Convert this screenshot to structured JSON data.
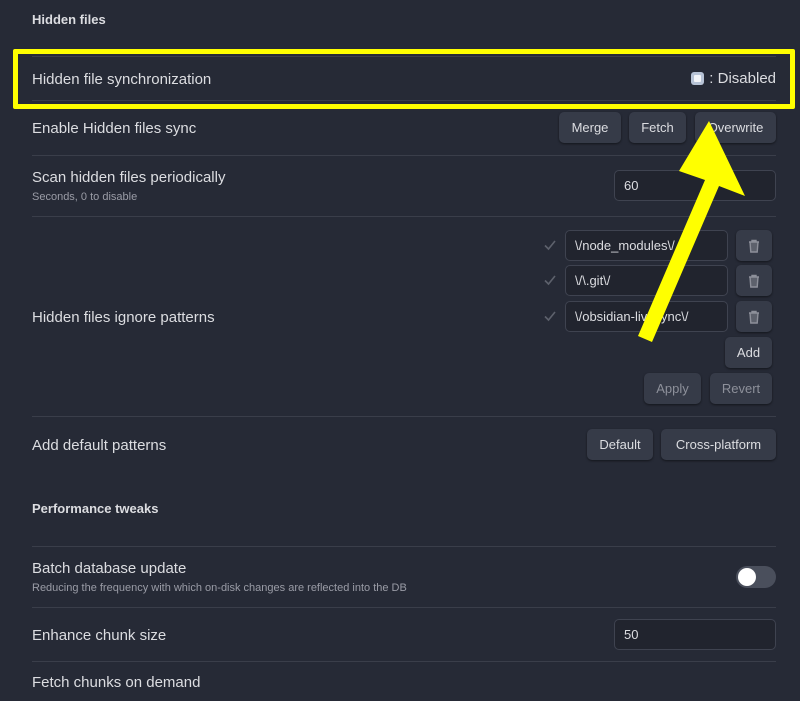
{
  "sections": {
    "hidden_files": "Hidden files",
    "performance": "Performance tweaks"
  },
  "hidden_sync": {
    "label": "Hidden file synchronization",
    "status": ": Disabled"
  },
  "enable_sync": {
    "label": "Enable Hidden files sync",
    "merge": "Merge",
    "fetch": "Fetch",
    "overwrite": "Overwrite"
  },
  "scan": {
    "label": "Scan hidden files periodically",
    "description": "Seconds, 0 to disable",
    "value": "60"
  },
  "ignore": {
    "label": "Hidden files ignore patterns",
    "patterns": [
      "\\/node_modules\\/",
      "\\/\\.git\\/",
      "\\/obsidian-livesync\\/"
    ],
    "add": "Add",
    "apply": "Apply",
    "revert": "Revert"
  },
  "defaults": {
    "label": "Add default patterns",
    "default": "Default",
    "cross_platform": "Cross-platform"
  },
  "batch": {
    "label": "Batch database update",
    "description": "Reducing the frequency with which on-disk changes are reflected into the DB",
    "enabled": false
  },
  "chunk": {
    "label": "Enhance chunk size",
    "value": "50"
  },
  "cut_off_label": "Fetch chunks on demand",
  "colors": {
    "background": "#262a36",
    "annotation": "#ffff00"
  }
}
